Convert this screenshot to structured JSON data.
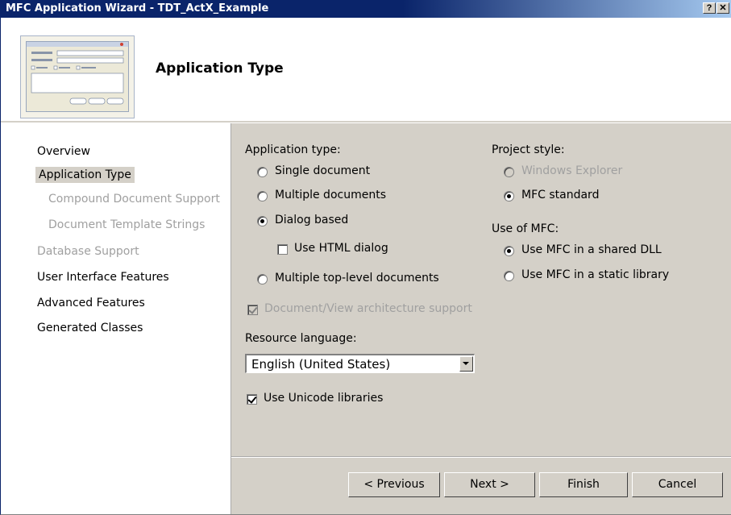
{
  "window": {
    "title": "MFC Application Wizard - TDT_ActX_Example",
    "help": "?",
    "close": "✕"
  },
  "header": {
    "title": "Application Type"
  },
  "nav": {
    "items": [
      {
        "label": "Overview"
      },
      {
        "label": "Application Type"
      },
      {
        "label": "Compound Document Support"
      },
      {
        "label": "Document Template Strings"
      },
      {
        "label": "Database Support"
      },
      {
        "label": "User Interface Features"
      },
      {
        "label": "Advanced Features"
      },
      {
        "label": "Generated Classes"
      }
    ]
  },
  "app_type": {
    "label": "Application type:",
    "single_document": "Single document",
    "multiple_documents": "Multiple documents",
    "dialog_based": "Dialog based",
    "use_html_dialog": "Use HTML dialog",
    "multiple_top_level": "Multiple top-level documents",
    "doc_view_support": "Document/View architecture support"
  },
  "project_style": {
    "label": "Project style:",
    "windows_explorer": "Windows Explorer",
    "mfc_standard": "MFC standard"
  },
  "use_of_mfc": {
    "label": "Use of MFC:",
    "shared_dll": "Use MFC in a shared DLL",
    "static_library": "Use MFC in a static library"
  },
  "resource_language": {
    "label": "Resource language:",
    "value": "English (United States)"
  },
  "unicode": {
    "label": "Use Unicode libraries"
  },
  "buttons": {
    "previous": "< Previous",
    "next": "Next >",
    "finish": "Finish",
    "cancel": "Cancel"
  }
}
